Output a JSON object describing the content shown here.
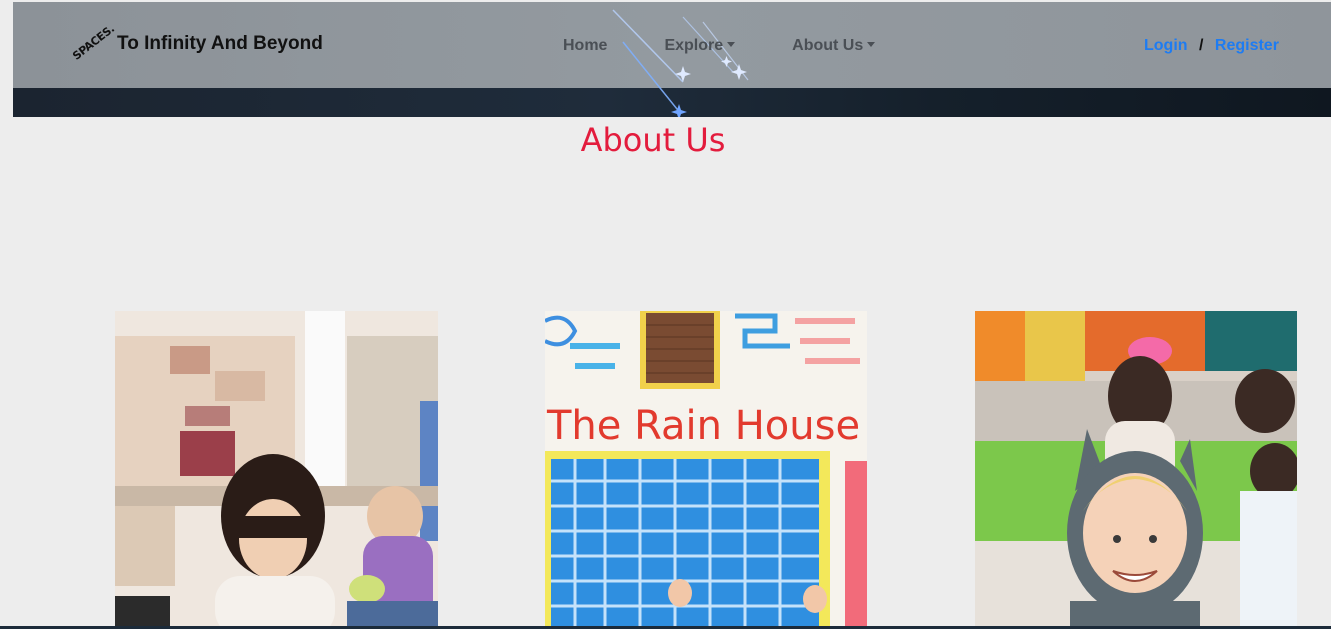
{
  "brand": {
    "logo_text": "SPACES.",
    "title": "To Infinity And Beyond"
  },
  "nav": {
    "home": "Home",
    "explore": "Explore",
    "about": "About Us"
  },
  "auth": {
    "login": "Login",
    "separator": "/",
    "register": "Register"
  },
  "page": {
    "title": "About Us"
  },
  "photos": {
    "second_sign_text": "The Rain House"
  },
  "colors": {
    "accent_title": "#e31c3d",
    "link": "#1e7cf2"
  }
}
